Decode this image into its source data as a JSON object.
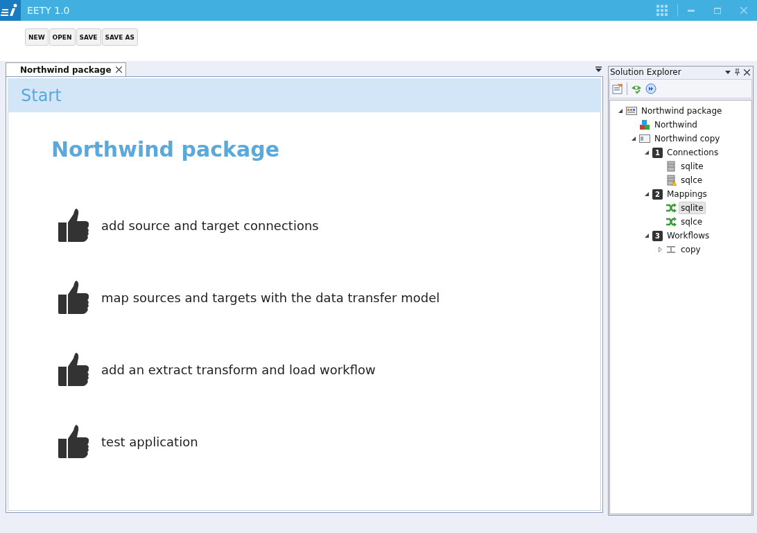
{
  "window": {
    "title": "EETY 1.0"
  },
  "toolbar": {
    "buttons": [
      "NEW",
      "OPEN",
      "SAVE",
      "SAVE AS"
    ]
  },
  "document_tabs": [
    {
      "label": "Northwind package",
      "selected": true
    }
  ],
  "start_page": {
    "header": "Start",
    "title": "Northwind package",
    "steps": [
      "add source and target connections",
      "map sources and targets with the data transfer model",
      "add an extract transform and load workflow",
      "test application"
    ]
  },
  "solution_explorer": {
    "title": "Solution Explorer",
    "tree": [
      {
        "label": "Northwind package",
        "kind": "package",
        "expanded": true,
        "selected": false,
        "children": [
          {
            "label": "Northwind",
            "kind": "model",
            "selected": false
          },
          {
            "label": "Northwind copy",
            "kind": "project",
            "expanded": true,
            "selected": false,
            "children": [
              {
                "label": "Connections",
                "kind": "group",
                "badge": "1",
                "expanded": true,
                "selected": false,
                "children": [
                  {
                    "label": "sqlite",
                    "kind": "connection",
                    "selected": false
                  },
                  {
                    "label": "sqlce",
                    "kind": "connection-warning",
                    "selected": false
                  }
                ]
              },
              {
                "label": "Mappings",
                "kind": "group",
                "badge": "2",
                "expanded": true,
                "selected": false,
                "children": [
                  {
                    "label": "sqlite",
                    "kind": "mapping",
                    "selected": true
                  },
                  {
                    "label": "sqlce",
                    "kind": "mapping",
                    "selected": false
                  }
                ]
              },
              {
                "label": "Workflows",
                "kind": "group",
                "badge": "3",
                "expanded": true,
                "selected": false,
                "children": [
                  {
                    "label": "copy",
                    "kind": "workflow",
                    "expanded": false,
                    "selected": false
                  }
                ]
              }
            ]
          }
        ]
      }
    ]
  }
}
